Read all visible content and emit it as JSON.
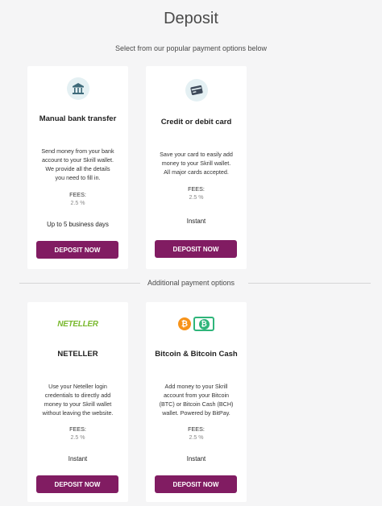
{
  "page": {
    "title": "Deposit",
    "subtitle": "Select from our popular payment options below",
    "additional_label": "Additional payment options"
  },
  "cards": [
    {
      "title": "Manual bank transfer",
      "icon": "bank-icon",
      "desc_lines": [
        "Send money from your bank",
        "account to your Skrill wallet.",
        "We provide all the details",
        "you need to fill in."
      ],
      "fees_label": "FEES:",
      "fees_value": "2.5 %",
      "time": "Up to 5 business days",
      "button": "DEPOSIT NOW"
    },
    {
      "title": "Credit or debit card",
      "icon": "credit-card-icon",
      "desc_lines": [
        "Save your card to easily add",
        "money to your Skrill wallet.",
        "All major cards accepted."
      ],
      "fees_label": "FEES:",
      "fees_value": "2.5 %",
      "time": "Instant",
      "button": "DEPOSIT NOW"
    },
    {
      "title": "NETELLER",
      "logo_text": "NETELLER",
      "icon": "neteller-logo",
      "desc_lines": [
        "Use your Neteller login",
        "credentials to directly add",
        "money to your Skrill wallet",
        "without leaving the website."
      ],
      "fees_label": "FEES:",
      "fees_value": "2.5 %",
      "time": "Instant",
      "button": "DEPOSIT NOW"
    },
    {
      "title": "Bitcoin & Bitcoin Cash",
      "icon": "bitcoin-icon",
      "desc_lines": [
        "Add money to your Skrill",
        "account from your Bitcoin",
        "(BTC) or Bitcoin Cash (BCH)",
        "wallet. Powered by BitPay."
      ],
      "fees_label": "FEES:",
      "fees_value": "2.5 %",
      "time": "Instant",
      "button": "DEPOSIT NOW"
    }
  ],
  "colors": {
    "background": "#f5f5f6",
    "button": "#811c62",
    "icon_circle": "#e4f0f3",
    "neteller_green": "#7ab92f",
    "bitcoin_orange": "#f7931a",
    "bch_green": "#2fb57a"
  }
}
